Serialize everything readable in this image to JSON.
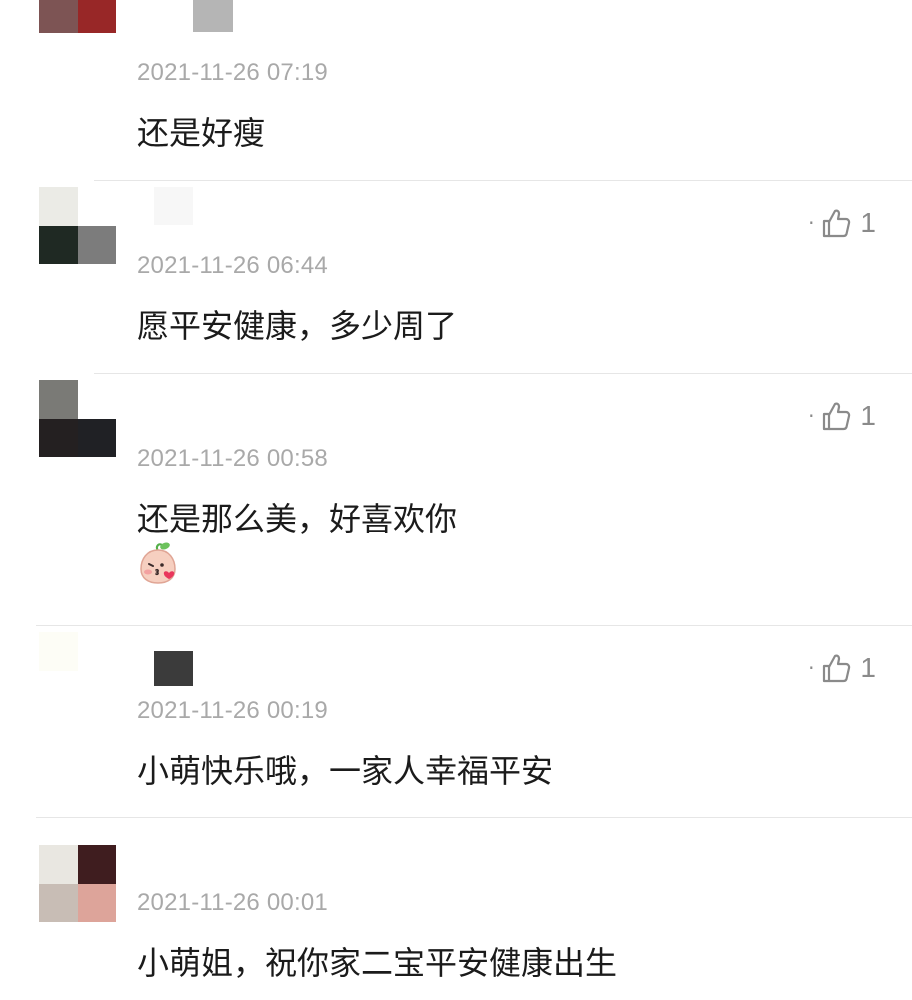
{
  "comments": [
    {
      "timestamp": "2021-11-26 07:19",
      "text": "还是好瘦",
      "likes": null,
      "avatar_colors": [
        "#7d5454",
        "#982727",
        "#ffffff",
        "#ffffff"
      ],
      "name_blur_color": "#b5b5b5"
    },
    {
      "timestamp": "2021-11-26 06:44",
      "text": "愿平安健康，多少周了",
      "likes": "1",
      "avatar_colors": [
        "#ebebe6",
        "#ffffff",
        "#1f2923",
        "#7c7c7c"
      ],
      "name_blur_color": "#f7f7f7"
    },
    {
      "timestamp": "2021-11-26 00:58",
      "text": "还是那么美，好喜欢你",
      "likes": "1",
      "avatar_colors": [
        "#7a7a76",
        "#ffffff",
        "#242021",
        "#202125"
      ],
      "name_blur_color": "#ffffff",
      "emoji": "blowing-kiss-emoji"
    },
    {
      "timestamp": "2021-11-26 00:19",
      "text": "小萌快乐哦，一家人幸福平安",
      "likes": "1",
      "avatar_colors": [
        "#fdfdf6",
        "#ffffff",
        "#ffffff",
        "#ffffff"
      ],
      "name_blur_color": "#3b3b3b"
    },
    {
      "timestamp": "2021-11-26 00:01",
      "text": "小萌姐，祝你家二宝平安健康出生",
      "likes": null,
      "avatar_colors": [
        "#e9e7e1",
        "#3f1d1f",
        "#c8bdb5",
        "#dda49a"
      ],
      "name_blur_color": "#ffffff"
    }
  ],
  "icons": {
    "like": "thumbs-up-icon",
    "more": "dot-icon"
  },
  "colors": {
    "timestamp": "#a9a9a9",
    "text": "#1b1b1b",
    "divider": "#e6e6e6",
    "like": "#8a8a8a"
  }
}
